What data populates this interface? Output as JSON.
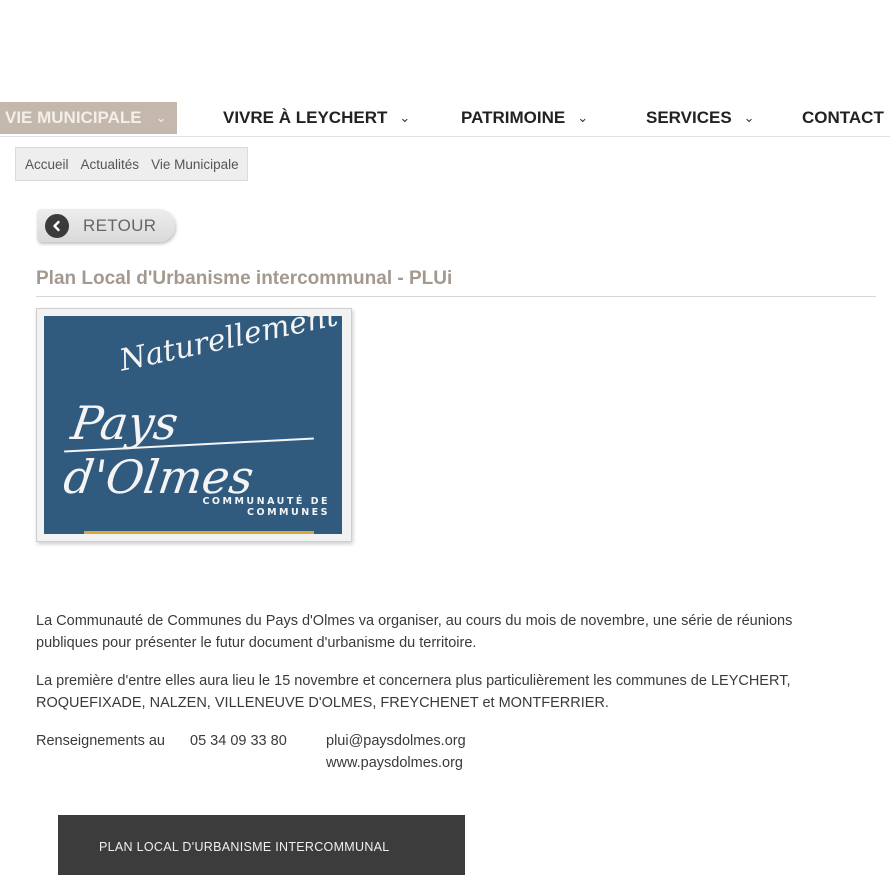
{
  "nav": {
    "items": [
      {
        "label": "VIE MUNICIPALE",
        "chevron": "⌄",
        "active": true
      },
      {
        "label": "VIVRE À LEYCHERT",
        "chevron": "⌄"
      },
      {
        "label": "PATRIMOINE",
        "chevron": "⌄"
      },
      {
        "label": "SERVICES",
        "chevron": "⌄"
      },
      {
        "label": "CONTACT"
      }
    ],
    "active_color": "#c4b7ab"
  },
  "breadcrumb": [
    "Accueil",
    "Actualités",
    "Vie Municipale"
  ],
  "back_button": {
    "label": "RETOUR",
    "icon": "chevron-left-circle-icon"
  },
  "article": {
    "title": "Plan Local d'Urbanisme intercommunal - PLUi",
    "logo": {
      "line1": "Naturellement",
      "line2": "Pays d'Olmes",
      "sub1": "COMMUNAUTÉ DE",
      "sub2": "COMMUNES",
      "bg_color": "#315a7f"
    },
    "paragraphs": [
      "La Communauté de Communes du Pays d'Olmes va organiser, au cours du mois de novembre, une série de réunions publiques pour présenter le futur document d'urbanisme du territoire.",
      "La première d'entre elles aura lieu le 15 novembre et concernera plus particulièrement les communes de LEYCHERT, ROQUEFIXADE, NALZEN, VILLENEUVE D'OLMES, FREYCHENET et MONTFERRIER."
    ],
    "contact": {
      "label": "Renseignements au",
      "phone": "05 34 09 33 80",
      "email": "plui@paysdolmes.org",
      "website": "www.paysdolmes.org"
    },
    "banner": "PLAN LOCAL D'URBANISME INTERCOMMUNAL"
  }
}
